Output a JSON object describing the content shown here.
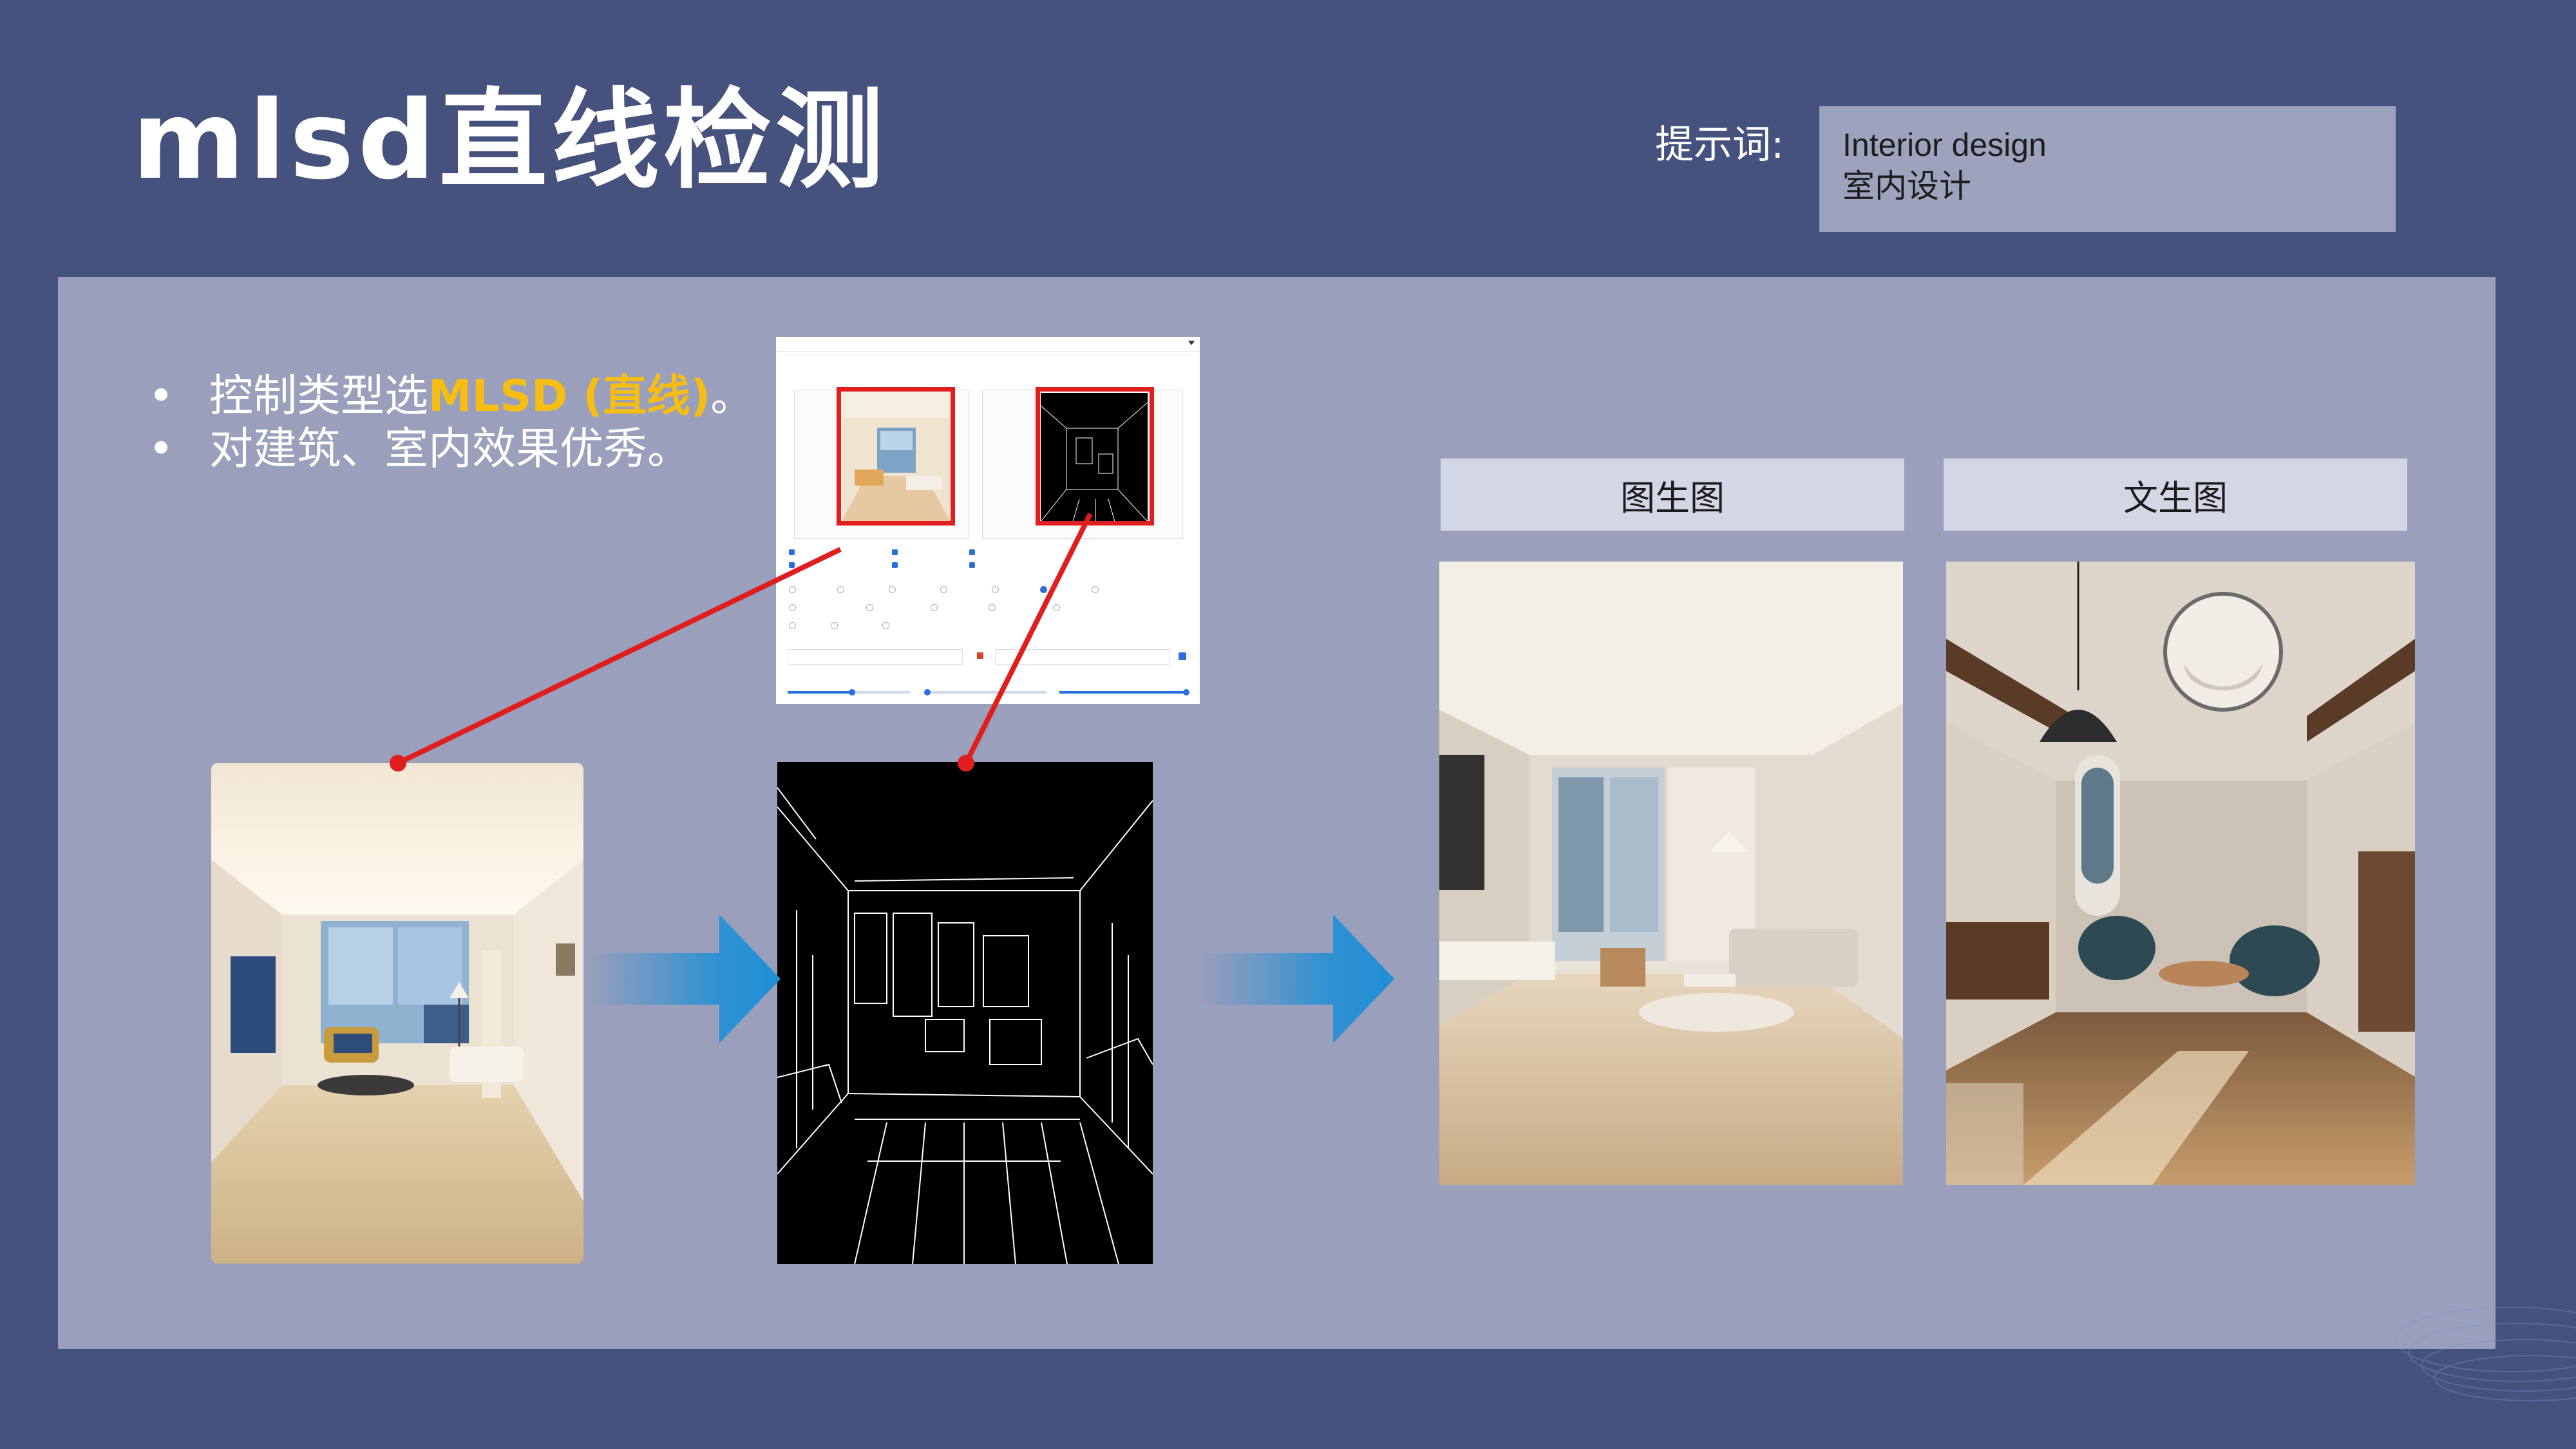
{
  "title": "mlsd直线检测",
  "prompt": {
    "label": "提示词:",
    "line1": "Interior design",
    "line2": "室内设计"
  },
  "bullets": [
    {
      "dot": "•",
      "text_before": "控制类型选",
      "highlight": "MLSD (直线)",
      "text_after": "。"
    },
    {
      "dot": "•",
      "text": "对建筑、室内效果优秀。"
    }
  ],
  "headers": {
    "img2img": "图生图",
    "txt2img": "文生图"
  },
  "colors": {
    "background": "#46527e",
    "panel": "#9a9fbb",
    "highlight": "#f6be13",
    "connector": "#e01e1e",
    "arrow": "#1f8fd6"
  },
  "icons": [
    "arrow-right-icon",
    "arrow-right-icon",
    "connector-line",
    "connector-line"
  ]
}
